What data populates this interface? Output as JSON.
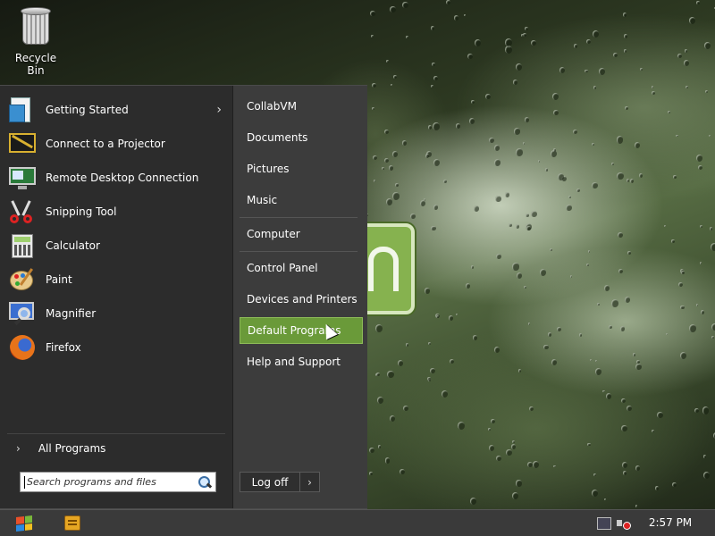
{
  "desktop": {
    "icons": [
      {
        "label": "Recycle Bin",
        "icon": "recycle-bin-icon"
      }
    ]
  },
  "start_menu": {
    "programs": [
      {
        "label": "Getting Started",
        "icon": "getting-started-icon",
        "has_submenu": true
      },
      {
        "label": "Connect to a Projector",
        "icon": "projector-icon"
      },
      {
        "label": "Remote Desktop Connection",
        "icon": "remote-desktop-icon"
      },
      {
        "label": "Snipping Tool",
        "icon": "scissors-icon"
      },
      {
        "label": "Calculator",
        "icon": "calculator-icon"
      },
      {
        "label": "Paint",
        "icon": "paint-palette-icon"
      },
      {
        "label": "Magnifier",
        "icon": "magnifier-icon"
      },
      {
        "label": "Firefox",
        "icon": "firefox-icon"
      }
    ],
    "all_programs_label": "All Programs",
    "search_placeholder": "Search programs and files",
    "places": [
      {
        "label": "CollabVM"
      },
      {
        "label": "Documents"
      },
      {
        "label": "Pictures"
      },
      {
        "label": "Music"
      },
      {
        "label": "Computer"
      },
      {
        "label": "Control Panel"
      },
      {
        "label": "Devices and Printers"
      },
      {
        "label": "Default Programs",
        "highlighted": true
      },
      {
        "label": "Help and Support"
      }
    ],
    "log_off_label": "Log off"
  },
  "taskbar": {
    "clock": "2:57 PM",
    "tray_icons": [
      "network-icon",
      "volume-muted-icon"
    ]
  },
  "colors": {
    "highlight": "#6a9a39",
    "menu_background": "#2c2c2c",
    "menu_right_background": "#3c3c3c",
    "taskbar": "#3a3a3a"
  }
}
